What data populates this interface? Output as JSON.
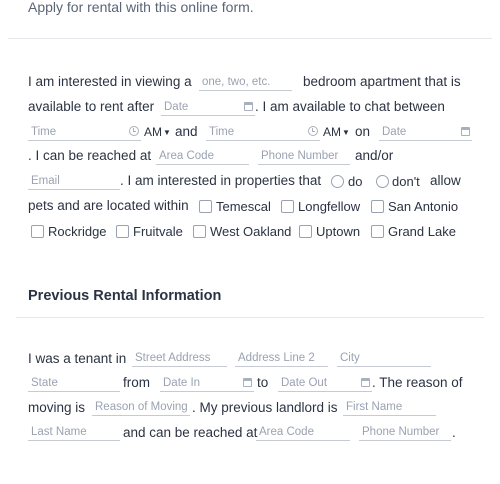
{
  "header": {
    "subtitle": "Apply for rental with this online form."
  },
  "rental_interest": {
    "t_interested": "I am interested in viewing a",
    "bedrooms_placeholder": "one, two, etc.",
    "t_bedroom_apt": "bedroom apartment that is",
    "t_available_after": "available to rent after",
    "date_placeholder": "Date",
    "t_chat": ". I am available to chat between",
    "time_placeholder": "Time",
    "ampm_1": "AM",
    "t_and": "and",
    "ampm_2": "AM",
    "t_on": "on",
    "t_reach": ". I can be reached at",
    "area_code_placeholder": "Area Code",
    "phone_placeholder": "Phone Number",
    "t_andor": "and/or",
    "email_placeholder": "Email",
    "t_properties": ". I am interested in properties that",
    "radio_do": "do",
    "radio_dont": "don't",
    "t_allow": "allow",
    "t_pets": "pets and are located within",
    "neighborhoods": [
      "Temescal",
      "Longfellow",
      "San Antonio",
      "Rockridge",
      "Fruitvale",
      "West Oakland",
      "Uptown",
      "Grand Lake"
    ]
  },
  "previous_rental": {
    "heading": "Previous Rental Information",
    "t_tenant_in": "I was a tenant in",
    "street_placeholder": "Street Address",
    "address2_placeholder": "Address Line 2",
    "city_placeholder": "City",
    "state_placeholder": "State",
    "t_from": "from",
    "date_in_placeholder": "Date In",
    "t_to": "to",
    "date_out_placeholder": "Date Out",
    "t_reason_of": ". The reason of",
    "t_moving_is": "moving is",
    "reason_placeholder": "Reason of Moving",
    "t_landlord": ". My previous landlord is",
    "first_name_placeholder": "First Name",
    "last_name_placeholder": "Last Name",
    "t_reached_at": "and can be reached at",
    "area_code_placeholder": "Area Code",
    "phone_placeholder": "Phone Number",
    "t_period": "."
  }
}
